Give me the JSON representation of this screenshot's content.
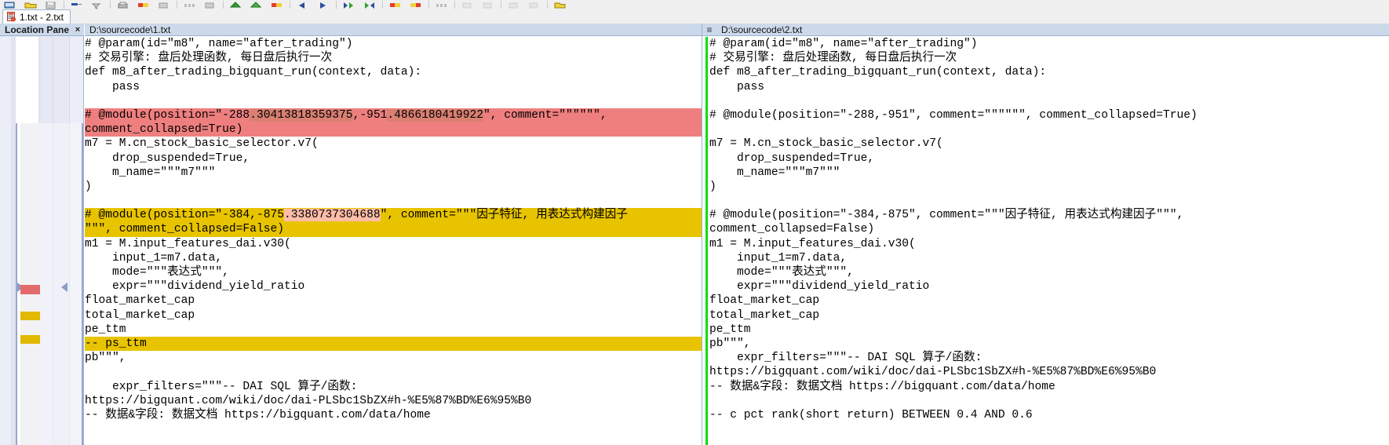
{
  "window": {
    "tab_label": "1.txt - 2.txt",
    "tab_icon": "document-compare-icon"
  },
  "toolbar": {
    "buttons": [
      {
        "name": "session-icon",
        "glyph": "session"
      },
      {
        "name": "open-folder-icon",
        "glyph": "folder"
      },
      {
        "name": "save-icon",
        "glyph": "save"
      },
      {
        "name": "sep",
        "glyph": "sep"
      },
      {
        "name": "rules-icon",
        "glyph": "rules"
      },
      {
        "name": "filter-icon",
        "glyph": "filter"
      },
      {
        "name": "sep",
        "glyph": "sep"
      },
      {
        "name": "print-icon",
        "glyph": "print"
      },
      {
        "name": "copy-left-icon",
        "glyph": "redyellow"
      },
      {
        "name": "swap-icon",
        "glyph": "gray"
      },
      {
        "name": "sep",
        "glyph": "sep"
      },
      {
        "name": "align-icon",
        "glyph": "graydots"
      },
      {
        "name": "compare-contents-icon",
        "glyph": "gray"
      },
      {
        "name": "sep",
        "glyph": "sep"
      },
      {
        "name": "previous-section-icon",
        "glyph": "greenup"
      },
      {
        "name": "next-section-icon",
        "glyph": "greenup2"
      },
      {
        "name": "next-difference-icon",
        "glyph": "redyellow"
      },
      {
        "name": "sep",
        "glyph": "sep"
      },
      {
        "name": "prev-diff-arrow-icon",
        "glyph": "blueleft"
      },
      {
        "name": "next-diff-arrow-icon",
        "glyph": "blueright"
      },
      {
        "name": "sep",
        "glyph": "sep"
      },
      {
        "name": "copy-to-right-icon",
        "glyph": "greenarrow"
      },
      {
        "name": "copy-to-left-icon",
        "glyph": "greenarrow2"
      },
      {
        "name": "sep",
        "glyph": "sep"
      },
      {
        "name": "copy-right-block-icon",
        "glyph": "redyellow"
      },
      {
        "name": "copy-left-block-icon",
        "glyph": "yellowred"
      },
      {
        "name": "sep",
        "glyph": "sep"
      },
      {
        "name": "show-all-icon",
        "glyph": "graydots"
      },
      {
        "name": "sep",
        "glyph": "sep"
      },
      {
        "name": "edit-left-icon",
        "glyph": "ghost"
      },
      {
        "name": "edit-right-icon",
        "glyph": "ghost"
      },
      {
        "name": "sep",
        "glyph": "sep"
      },
      {
        "name": "undo-icon",
        "glyph": "ghost"
      },
      {
        "name": "redo-icon",
        "glyph": "ghost"
      },
      {
        "name": "sep",
        "glyph": "sep"
      },
      {
        "name": "save-as-icon",
        "glyph": "yellowsave"
      }
    ]
  },
  "location_pane": {
    "title": "Location Pane",
    "close_label": "×",
    "markers": [
      {
        "name": "difference-marker-red",
        "color": "#e36b6b"
      },
      {
        "name": "difference-marker-yellow-1",
        "color": "#e2b800"
      },
      {
        "name": "difference-marker-yellow-2",
        "color": "#e2b800"
      }
    ]
  },
  "left_pane": {
    "path": "D:\\sourcecode\\1.txt",
    "hamburger": "",
    "lines": [
      {
        "type": "plain",
        "text": "# @param(id=\"m8\", name=\"after_trading\")"
      },
      {
        "type": "plain",
        "text": "# 交易引擎: 盘后处理函数, 每日盘后执行一次"
      },
      {
        "type": "plain",
        "text": "def m8_after_trading_bigquant_run(context, data):"
      },
      {
        "type": "plain",
        "text": "    pass"
      },
      {
        "type": "plain",
        "text": ""
      },
      {
        "type": "diff-red",
        "segments": [
          {
            "t": "# @module(position=\"-288",
            "hl": "red"
          },
          {
            "t": ".30413818359375",
            "hl": "red-dark"
          },
          {
            "t": ",-951",
            "hl": "red"
          },
          {
            "t": ".4866180419922",
            "hl": "red-dark"
          },
          {
            "t": "\", comment=\"\"\"\"\"\",",
            "hl": "red"
          }
        ]
      },
      {
        "type": "diff-red",
        "segments": [
          {
            "t": "comment_collapsed=True)",
            "hl": "red"
          }
        ]
      },
      {
        "type": "plain",
        "text": "m7 = M.cn_stock_basic_selector.v7("
      },
      {
        "type": "plain",
        "text": "    drop_suspended=True,"
      },
      {
        "type": "plain",
        "text": "    m_name=\"\"\"m7\"\"\""
      },
      {
        "type": "plain",
        "text": ")"
      },
      {
        "type": "plain",
        "text": ""
      },
      {
        "type": "diff-yellow",
        "segments": [
          {
            "t": "# @module(position=\"-384,-875",
            "hl": "yellow"
          },
          {
            "t": ".3380737304688",
            "hl": "pink"
          },
          {
            "t": "\", comment=\"\"\"因子特征, 用表达式构建因子",
            "hl": "yellow"
          }
        ]
      },
      {
        "type": "diff-yellow",
        "segments": [
          {
            "t": "\"\"\", comment_collapsed=False)",
            "hl": "yellow"
          }
        ]
      },
      {
        "type": "plain",
        "text": "m1 = M.input_features_dai.v30("
      },
      {
        "type": "plain",
        "text": "    input_1=m7.data,"
      },
      {
        "type": "plain",
        "text": "    mode=\"\"\"表达式\"\"\","
      },
      {
        "type": "plain",
        "text": "    expr=\"\"\"dividend_yield_ratio"
      },
      {
        "type": "plain",
        "text": "float_market_cap"
      },
      {
        "type": "plain",
        "text": "total_market_cap"
      },
      {
        "type": "plain",
        "text": "pe_ttm"
      },
      {
        "type": "diff-yellow",
        "segments": [
          {
            "t": "-- ps_ttm",
            "hl": "yellow"
          }
        ]
      },
      {
        "type": "plain",
        "text": "pb\"\"\","
      },
      {
        "type": "plain",
        "text": ""
      },
      {
        "type": "plain",
        "text": "    expr_filters=\"\"\"-- DAI SQL 算子/函数:"
      },
      {
        "type": "plain",
        "text": "https://bigquant.com/wiki/doc/dai-PLSbc1SbZX#h-%E5%87%BD%E6%95%B0"
      },
      {
        "type": "plain",
        "text": "-- 数据&字段: 数据文档 https://bigquant.com/data/home"
      }
    ]
  },
  "right_pane": {
    "path": "D:\\sourcecode\\2.txt",
    "hamburger": "≡",
    "lines": [
      {
        "type": "plain",
        "text": "# @param(id=\"m8\", name=\"after_trading\")"
      },
      {
        "type": "plain",
        "text": "# 交易引擎: 盘后处理函数, 每日盘后执行一次"
      },
      {
        "type": "plain",
        "text": "def m8_after_trading_bigquant_run(context, data):"
      },
      {
        "type": "plain",
        "text": "    pass"
      },
      {
        "type": "plain",
        "text": ""
      },
      {
        "type": "plain",
        "text": "# @module(position=\"-288,-951\", comment=\"\"\"\"\"\", comment_collapsed=True)"
      },
      {
        "type": "plain",
        "text": ""
      },
      {
        "type": "plain",
        "text": "m7 = M.cn_stock_basic_selector.v7("
      },
      {
        "type": "plain",
        "text": "    drop_suspended=True,"
      },
      {
        "type": "plain",
        "text": "    m_name=\"\"\"m7\"\"\""
      },
      {
        "type": "plain",
        "text": ")"
      },
      {
        "type": "plain",
        "text": ""
      },
      {
        "type": "plain",
        "text": "# @module(position=\"-384,-875\", comment=\"\"\"因子特征, 用表达式构建因子\"\"\","
      },
      {
        "type": "plain",
        "text": "comment_collapsed=False)"
      },
      {
        "type": "plain",
        "text": "m1 = M.input_features_dai.v30("
      },
      {
        "type": "plain",
        "text": "    input_1=m7.data,"
      },
      {
        "type": "plain",
        "text": "    mode=\"\"\"表达式\"\"\","
      },
      {
        "type": "plain",
        "text": "    expr=\"\"\"dividend_yield_ratio"
      },
      {
        "type": "plain",
        "text": "float_market_cap"
      },
      {
        "type": "plain",
        "text": "total_market_cap"
      },
      {
        "type": "plain",
        "text": "pe_ttm"
      },
      {
        "type": "plain",
        "text": "pb\"\"\","
      },
      {
        "type": "plain",
        "text": "    expr_filters=\"\"\"-- DAI SQL 算子/函数:"
      },
      {
        "type": "plain",
        "text": "https://bigquant.com/wiki/doc/dai-PLSbc1SbZX#h-%E5%87%BD%E6%95%B0"
      },
      {
        "type": "plain",
        "text": "-- 数据&字段: 数据文档 https://bigquant.com/data/home"
      },
      {
        "type": "plain",
        "text": ""
      },
      {
        "type": "plain",
        "text": "-- c pct rank(short return) BETWEEN 0.4 AND 0.6"
      }
    ]
  },
  "colors": {
    "diff_red": "#ef7f7f",
    "diff_red_inline": "#d98072",
    "diff_yellow": "#e8c400",
    "diff_pink_inline": "#ffbda8",
    "gutter_green": "#00e000",
    "header_bg": "#ccd9ea",
    "border": "#9db4d0"
  }
}
